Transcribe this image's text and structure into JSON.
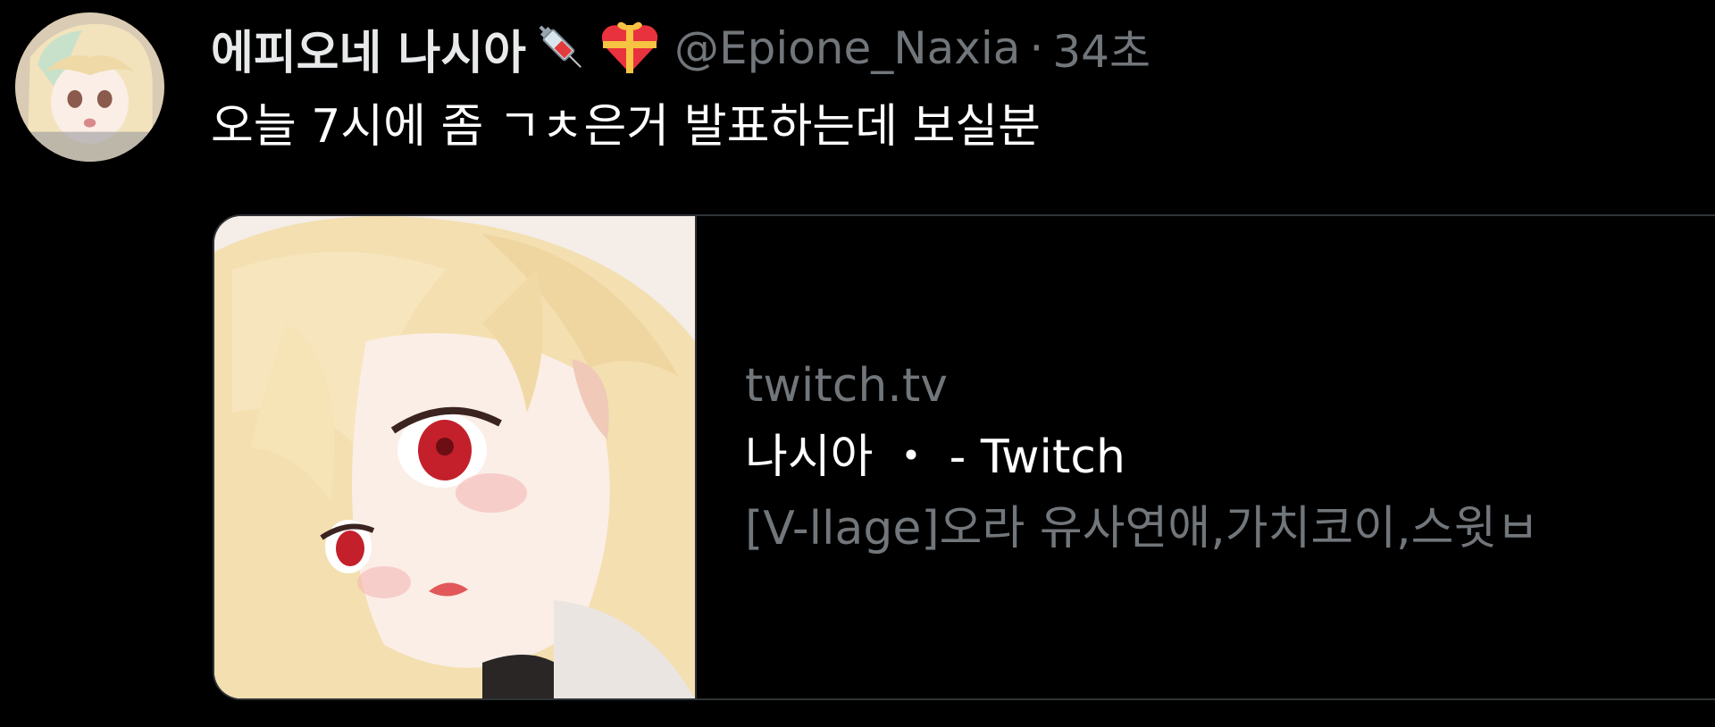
{
  "tweet": {
    "display_name": "에피오네 나시아",
    "handle": "@Epione_Naxia",
    "separator": "·",
    "time": "34초",
    "text": "오늘 7시에 좀 ㄱㅊ은거 발표하는데 보실분",
    "badges": [
      "syringe-icon",
      "gift-heart-icon"
    ]
  },
  "card": {
    "domain": "twitch.tv",
    "title": "나시아 ・ - Twitch",
    "description": "[V-llage]오라 유사연애,가치코이,스윗ㅂ"
  },
  "colors": {
    "background": "#000000",
    "primary_text": "#e7e9ea",
    "secondary_text": "#71767b",
    "border": "#2f3336"
  }
}
